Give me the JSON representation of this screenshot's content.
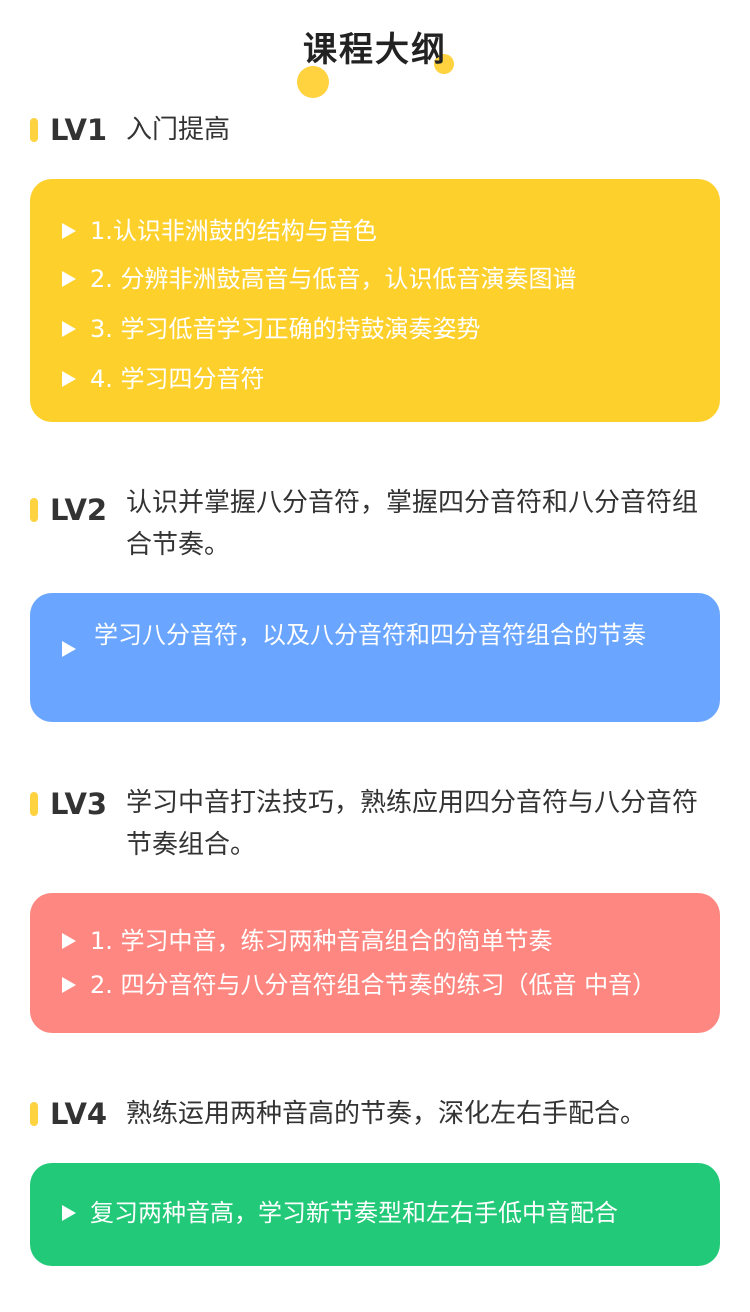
{
  "page": {
    "title": "课程大纲"
  },
  "levels": [
    {
      "code": "LV1",
      "description": "入门提高",
      "color": "#fed02c",
      "items": [
        "1.认识非洲鼓的结构与音色",
        "2. 分辨非洲鼓高音与低音，认识低音演奏图谱",
        "3. 学习低音学习正确的持鼓演奏姿势",
        "4. 学习四分音符"
      ]
    },
    {
      "code": "LV2",
      "description": "认识并掌握八分音符，掌握四分音符和八分音符组合节奏。",
      "color": "#6aa6ff",
      "items": [
        "学习八分音符，以及八分音符和四分音符组合的节奏"
      ]
    },
    {
      "code": "LV3",
      "description": "学习中音打法技巧，熟练应用四分音符与八分音符节奏组合。",
      "color": "#fe8881",
      "items": [
        "1. 学习中音，练习两种音高组合的简单节奏",
        "2. 四分音符与八分音符组合节奏的练习（低音 中音）"
      ]
    },
    {
      "code": "LV4",
      "description": "熟练运用两种音高的节奏，深化左右手配合。",
      "color": "#21c978",
      "items": [
        "复习两种音高，学习新节奏型和左右手低中音配合"
      ]
    }
  ],
  "accent_color": "#ffd23f",
  "icons": {
    "bullet": "play-triangle-icon",
    "heading_marker": "yellow-bar-icon"
  }
}
